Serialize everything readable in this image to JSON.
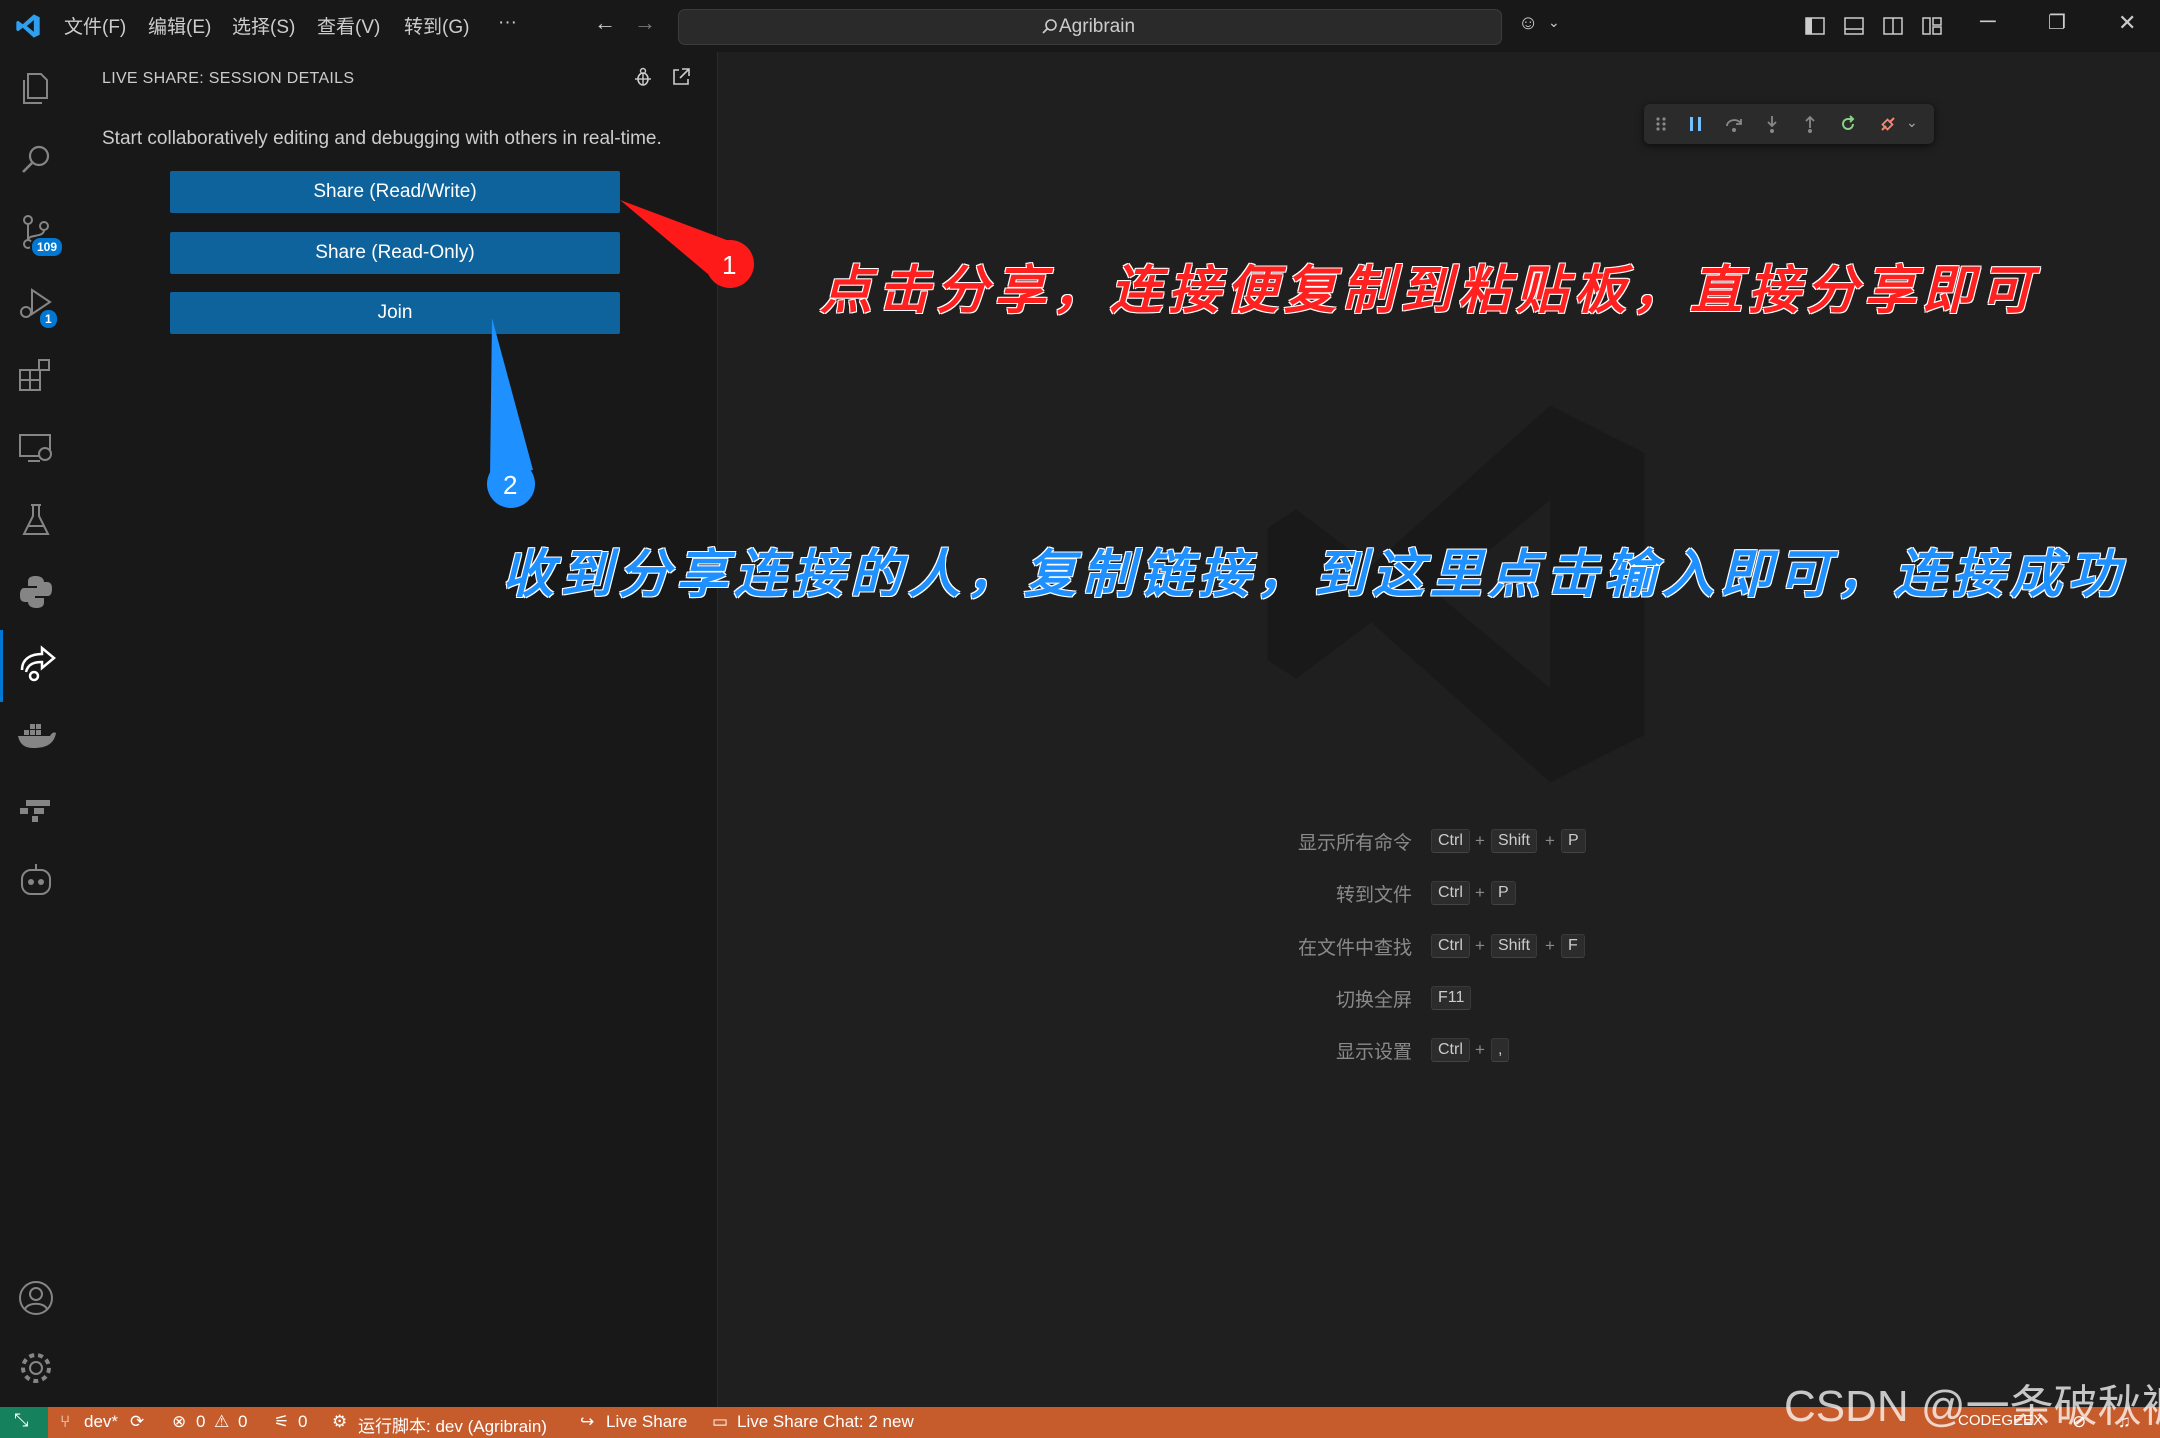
{
  "titlebar": {
    "menus": [
      "文件(F)",
      "编辑(E)",
      "选择(S)",
      "查看(V)",
      "转到(G)",
      "···"
    ],
    "search_text": "Agribrain"
  },
  "activitybar": {
    "items": [
      "explorer-icon",
      "search-icon",
      "source-control-icon",
      "run-debug-icon",
      "extensions-icon",
      "remote-explorer-icon",
      "testing-icon",
      "python-icon",
      "live-share-icon",
      "docker-icon",
      "gitlens-icon",
      "copilot-icon"
    ],
    "scm_badge": "109",
    "debug_badge": "1",
    "bottom": [
      "account-icon",
      "settings-gear-icon"
    ]
  },
  "sidebar": {
    "title": "LIVE SHARE: SESSION DETAILS",
    "description": "Start collaboratively editing and debugging with others in real-time.",
    "buttons": {
      "share_rw": "Share (Read/Write)",
      "share_ro": "Share (Read-Only)",
      "join": "Join"
    }
  },
  "editor": {
    "shortcuts": [
      {
        "label": "显示所有命令",
        "keys": [
          "Ctrl",
          "Shift",
          "P"
        ]
      },
      {
        "label": "转到文件",
        "keys": [
          "Ctrl",
          "P"
        ]
      },
      {
        "label": "在文件中查找",
        "keys": [
          "Ctrl",
          "Shift",
          "F"
        ]
      },
      {
        "label": "切换全屏",
        "keys": [
          "F11"
        ]
      },
      {
        "label": "显示设置",
        "keys": [
          "Ctrl",
          ","
        ]
      }
    ]
  },
  "annotations": {
    "marker1": "1",
    "marker2": "2",
    "text1": "点击分享，连接便复制到粘贴板，直接分享即可",
    "text2": "收到分享连接的人，复制链接，到这里点击输入即可，连接成功"
  },
  "statusbar": {
    "branch": "dev*",
    "errors": "0",
    "warnings": "0",
    "ports": "0",
    "run_script": "运行脚本: dev (Agribrain)",
    "live_share": "Live Share",
    "live_share_chat": "Live Share Chat: 2 new",
    "codegeex": "CODEGEEX"
  },
  "watermark": "CSDN @一条破秋裤",
  "colors": {
    "accent": "#0078d4",
    "button": "#0e639c",
    "statusbar": "#c65b2b",
    "annotation_red": "#ff2020",
    "annotation_blue": "#1e90ff"
  }
}
